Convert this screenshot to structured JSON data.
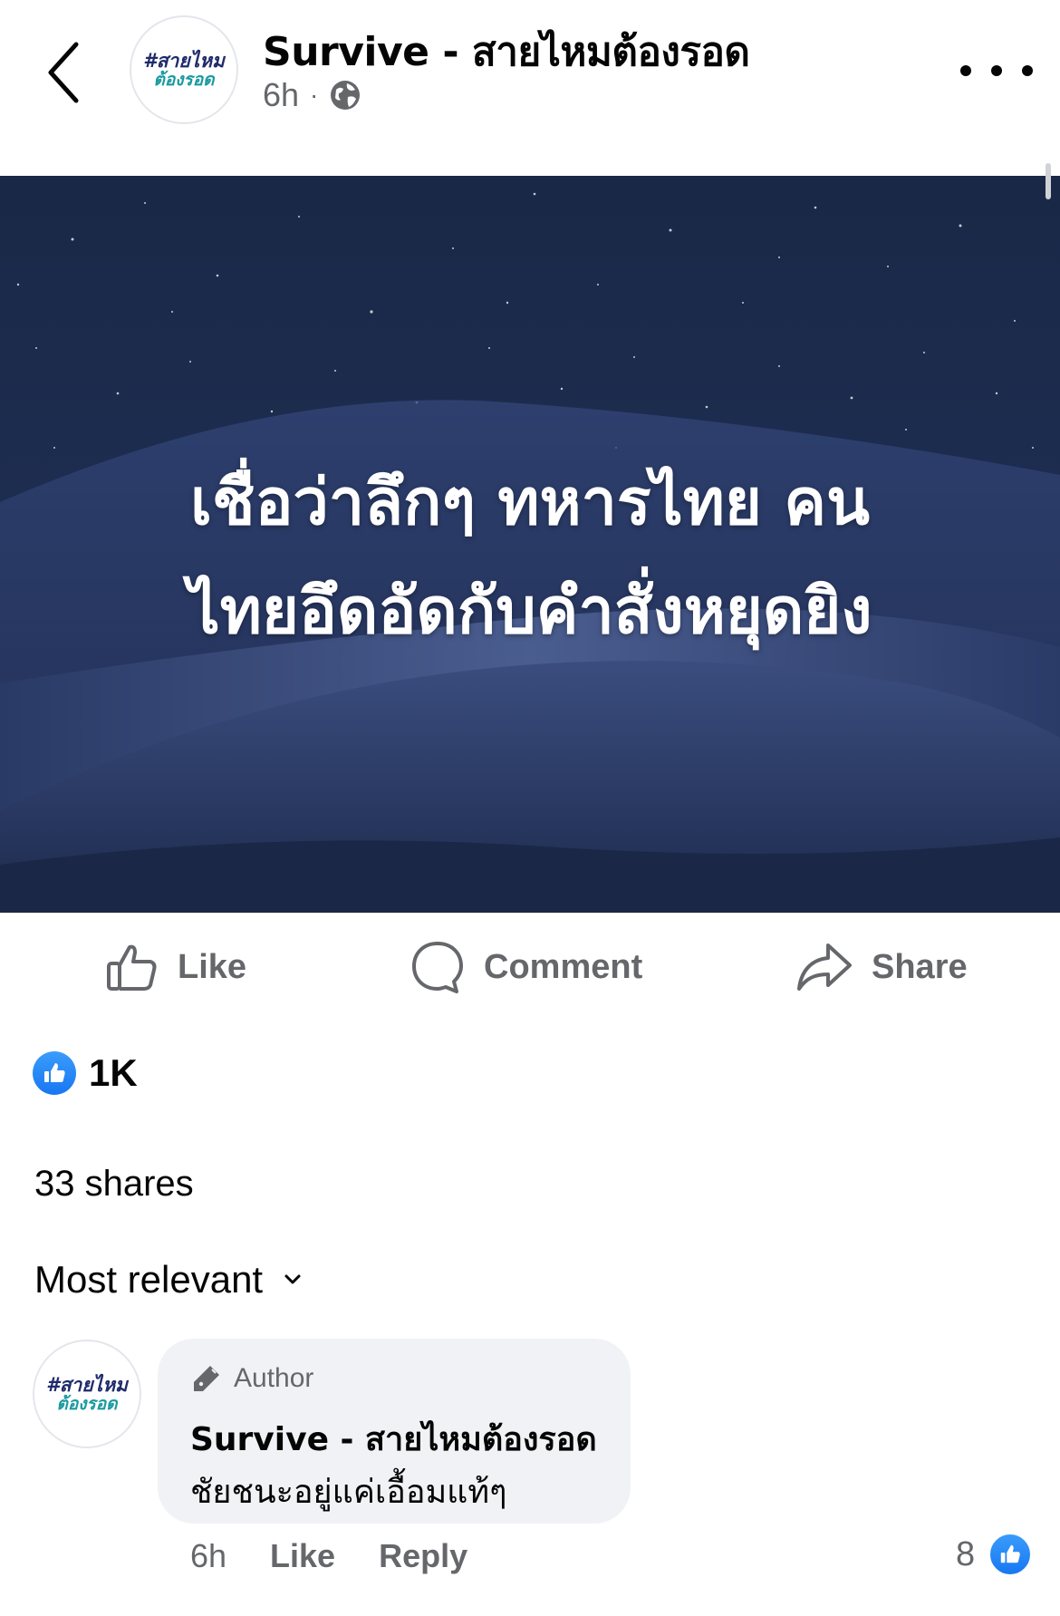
{
  "header": {
    "page_name": "Survive - สายไหมต้องรอด",
    "time": "6h",
    "separator": "·",
    "avatar": {
      "line1": "#สายไหม",
      "line2": "ต้องรอด"
    }
  },
  "post": {
    "image_text_line1": "เชื่อว่าลึกๆ ทหารไทย คน",
    "image_text_line2": "ไทยอึดอัดกับคำสั่งหยุดยิง"
  },
  "actions": {
    "like": "Like",
    "comment": "Comment",
    "share": "Share"
  },
  "reactions": {
    "count": "1K"
  },
  "shares": {
    "label": "33 shares"
  },
  "sort": {
    "label": "Most relevant"
  },
  "comment": {
    "badge": "Author",
    "author": "Survive - สายไหมต้องรอด",
    "text": "ชัยชนะอยู่แค่เอื้อมแท้ๆ",
    "time": "6h",
    "like": "Like",
    "reply": "Reply",
    "like_count": "8",
    "avatar": {
      "line1": "#สายไหม",
      "line2": "ต้องรอด"
    }
  },
  "colors": {
    "accent": "#1877f2",
    "secondary_text": "#65676b",
    "bubble_bg": "#f0f2f5",
    "logo_navy": "#1f2b6b",
    "logo_teal": "#1a9aa0"
  },
  "icons": [
    "back-chevron-icon",
    "globe-icon",
    "more-dots-icon",
    "thumbs-up-icon",
    "comment-bubble-icon",
    "share-arrow-icon",
    "like-reaction-icon",
    "chevron-down-icon",
    "pen-icon"
  ]
}
